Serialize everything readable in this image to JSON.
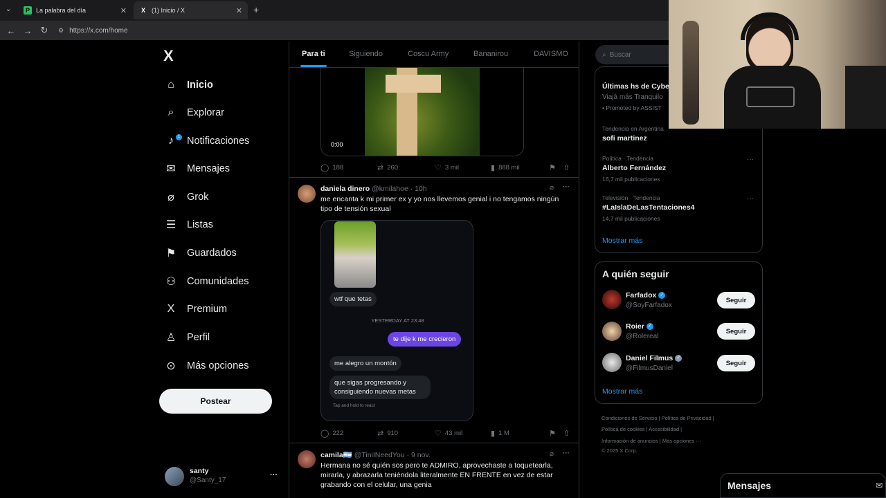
{
  "browser": {
    "tabs": [
      {
        "title": "La palabra del día",
        "favicon": "P"
      },
      {
        "title": "(1) Inicio / X",
        "favicon": "X"
      }
    ],
    "new_tab": "+",
    "url": "https://x.com/home"
  },
  "sidebar": {
    "logo": "X",
    "items": [
      {
        "label": "Inicio",
        "icon": "home-icon",
        "glyph": "⌂"
      },
      {
        "label": "Explorar",
        "icon": "search-icon",
        "glyph": "⌕"
      },
      {
        "label": "Notificaciones",
        "icon": "bell-icon",
        "glyph": "♪",
        "badge": "1"
      },
      {
        "label": "Mensajes",
        "icon": "mail-icon",
        "glyph": "✉"
      },
      {
        "label": "Grok",
        "icon": "grok-icon",
        "glyph": "⌀"
      },
      {
        "label": "Listas",
        "icon": "list-icon",
        "glyph": "☰"
      },
      {
        "label": "Guardados",
        "icon": "bookmark-icon",
        "glyph": "⚑"
      },
      {
        "label": "Comunidades",
        "icon": "communities-icon",
        "glyph": "⚇"
      },
      {
        "label": "Premium",
        "icon": "x-premium-icon",
        "glyph": "X"
      },
      {
        "label": "Perfil",
        "icon": "person-icon",
        "glyph": "♙"
      },
      {
        "label": "Más opciones",
        "icon": "more-circle-icon",
        "glyph": "⊙"
      }
    ],
    "post_button": "Postear",
    "account": {
      "name": "santy",
      "handle": "@Santy_17",
      "more": "···"
    }
  },
  "feed": {
    "tabs": [
      "Para ti",
      "Siguiendo",
      "Coscu Army",
      "Bananirou",
      "DAVISMO"
    ],
    "tweets": [
      {
        "video_time": "0:00",
        "stats": {
          "replies": "188",
          "retweets": "260",
          "likes": "3 mil",
          "views": "888 mil"
        }
      },
      {
        "name": "daniela dinero",
        "handle": "@kmilahoe · 10h",
        "text": "me encanta k mi primer ex y yo nos llevemos genial i no tengamos ningún tipo de tensión sexual",
        "chat": {
          "msg1": "wtf que tetas",
          "date": "YESTERDAY AT 23:48",
          "sent": "te dije k me crecieron",
          "msg2": "me alegro un montón",
          "msg3": "que sigas progresando y consiguiendo nuevas metas",
          "hint": "Tap and hold to react"
        },
        "stats": {
          "replies": "222",
          "retweets": "910",
          "likes": "43 mil",
          "views": "1 M"
        }
      },
      {
        "name": "camila🇦🇷",
        "handle": "@TiniINeedYou · 9 nov.",
        "text": "Hermana no sé quién sos pero te ADMIRO, aprovechaste a toquetearla, mirarla, y abrazarla teniéndola literalmente EN FRENTE en vez de estar grabando con el celular, una genia"
      }
    ]
  },
  "right": {
    "search_placeholder": "Buscar",
    "promo": {
      "title": "Últimas hs de Cybe",
      "subtitle": "Viajá más Tranquilo",
      "promoted": "Promoted by ASSIST"
    },
    "trends": [
      {
        "meta": "Tendencia en Argentina",
        "name": "sofi martinez",
        "posts": ""
      },
      {
        "meta": "Política · Tendencia",
        "name": "Alberto Fernández",
        "posts": "16,7 mil publicaciones"
      },
      {
        "meta": "Televisión · Tendencia",
        "name": "#LaIslaDeLasTentaciones4",
        "posts": "14,7 mil publicaciones"
      }
    ],
    "show_more": "Mostrar más",
    "who_to_follow": {
      "title": "A quién seguir",
      "users": [
        {
          "name": "Farfadox",
          "handle": "@SoyFarfadox",
          "button": "Seguir"
        },
        {
          "name": "Roier",
          "handle": "@Rolereal",
          "button": "Seguir"
        },
        {
          "name": "Daniel Filmus",
          "handle": "@FilmusDaniel",
          "button": "Seguir"
        }
      ],
      "show_more": "Mostrar más"
    },
    "footer": {
      "line1": "Condiciones de Servicio  |  Política de Privacidad  |",
      "line2": "Política de cookies  |  Accesibilidad  |",
      "line3": "Información de anuncios  |  Más opciones ···",
      "line4": "© 2025 X Corp."
    }
  },
  "messages_bar": {
    "label": "Mensajes"
  },
  "colors": {
    "accent": "#1d9bf0",
    "background": "#000000",
    "border": "#2f3336",
    "muted": "#71767b",
    "chat_bubble_sent": "#6b46e5"
  }
}
